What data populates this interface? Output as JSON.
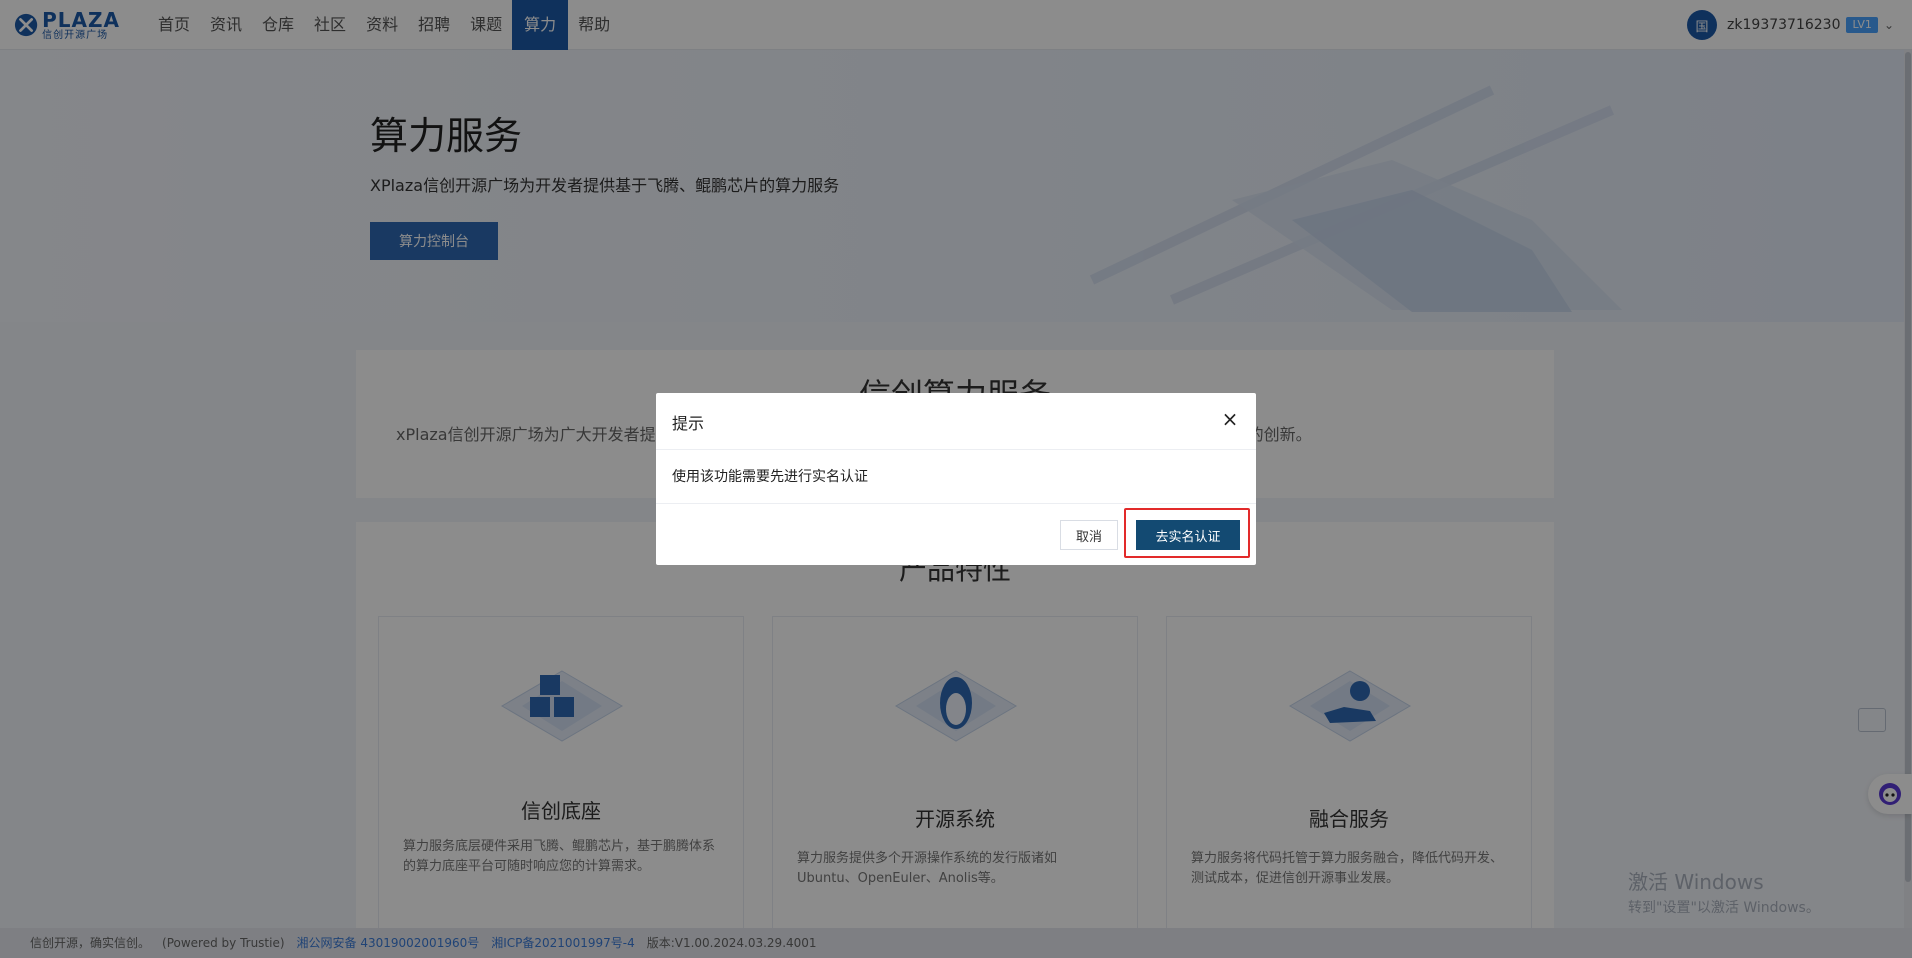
{
  "header": {
    "logo": {
      "main": "PLAZA",
      "sub": "信创开源广场"
    },
    "nav": [
      "首页",
      "资讯",
      "仓库",
      "社区",
      "资料",
      "招聘",
      "课题",
      "算力",
      "帮助"
    ],
    "active_nav": "算力",
    "user": {
      "avatar": "国",
      "name": "zk19373716230",
      "level": "LV1"
    }
  },
  "hero": {
    "title": "算力服务",
    "subtitle": "XPlaza信创开源广场为开发者提供基于飞腾、鲲鹏芯片的算力服务",
    "button": "算力控制台"
  },
  "section": {
    "title": "信创算力服务",
    "desc": "xPlaza信创开源广场为广大开发者提供基于飞腾、鲲鹏芯片的算力服务，大幅降低应用开发测试成本，让您更专注于业务的创新。"
  },
  "products": {
    "title": "产品特性",
    "items": [
      {
        "title": "信创底座",
        "desc": "算力服务底层硬件采用飞腾、鲲鹏芯片，基于鹏腾体系的算力底座平台可随时响应您的计算需求。"
      },
      {
        "title": "开源系统",
        "desc": "算力服务提供多个开源操作系统的发行版诸如Ubuntu、OpenEuler、Anolis等。"
      },
      {
        "title": "融合服务",
        "desc": "算力服务将代码托管于算力服务融合，降低代码开发、测试成本，促进信创开源事业发展。"
      }
    ]
  },
  "footer": {
    "slogan": "信创开源，确实信创。",
    "powered": "(Powered by Trustie)",
    "police": "湘公网安备 43019002001960号",
    "icp": "湘ICP备2021001997号-4",
    "version": "版本:V1.00.2024.03.29.4001"
  },
  "watermark": {
    "line1": "激活 Windows",
    "line2": "转到\"设置\"以激活 Windows。"
  },
  "modal": {
    "title": "提示",
    "close": "×",
    "message": "使用该功能需要先进行实名认证",
    "cancel": "取消",
    "confirm": "去实名认证"
  },
  "colors": {
    "brand": "#1d5aa8",
    "confirm": "#134a72",
    "highlight": "#e22a2a"
  },
  "icons": {
    "close": "close-icon",
    "chevron": "chevron-down-icon",
    "robot": "robot-icon",
    "chat": "chat-icon"
  }
}
